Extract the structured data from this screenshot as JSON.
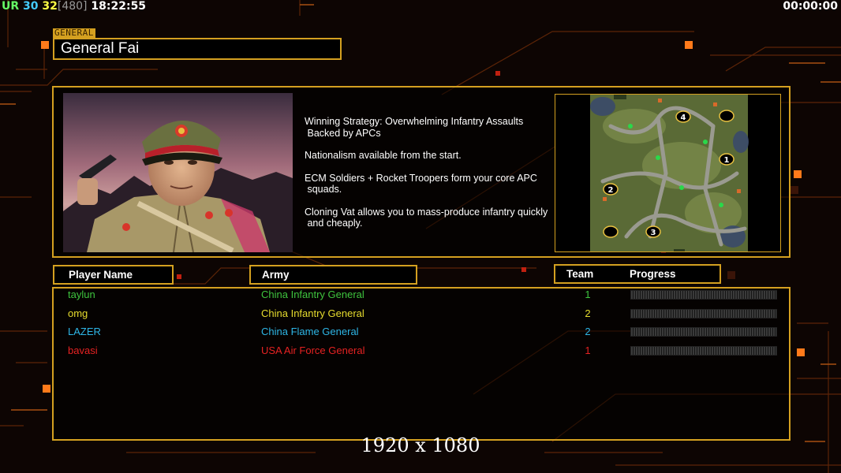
{
  "hud": {
    "left": {
      "ur": "UR",
      "n30": "30",
      "n32": "32",
      "n480": "[480]",
      "clock": "18:22:55"
    },
    "right_timer": "00:00:00"
  },
  "general": {
    "tag": "GENERAL",
    "name": "General Fai",
    "portrait_icon": "general-fai-portrait",
    "strategy": [
      "Winning Strategy: Overwhelming Infantry Assaults\n Backed by APCs",
      "Nationalism available from the start.",
      "ECM Soldiers + Rocket Troopers form your core APC\n squads.",
      "Cloning Vat allows you to mass-produce infantry quickly\n and cheaply."
    ]
  },
  "map": {
    "icon": "minimap",
    "start_positions": [
      "4",
      "1",
      "2",
      "3"
    ]
  },
  "table": {
    "headers": {
      "player": "Player Name",
      "army": "Army",
      "team": "Team",
      "progress": "Progress"
    },
    "rows": [
      {
        "name": "taylun",
        "army": "China Infantry General",
        "team": "1",
        "color": "#3ec43e",
        "progress": 0
      },
      {
        "name": "omg",
        "army": "China Infantry General",
        "team": "2",
        "color": "#e6dc2e",
        "progress": 0
      },
      {
        "name": "LAZER",
        "army": "China Flame General",
        "team": "2",
        "color": "#2eb6e6",
        "progress": 0
      },
      {
        "name": "bavasi",
        "army": "USA Air Force General",
        "team": "1",
        "color": "#e62222",
        "progress": 0
      }
    ]
  },
  "resolution": "1920 x 1080",
  "colors": {
    "accent": "#d4a020",
    "background": "#0d0503",
    "hud_orange": "#ff7a1a"
  }
}
